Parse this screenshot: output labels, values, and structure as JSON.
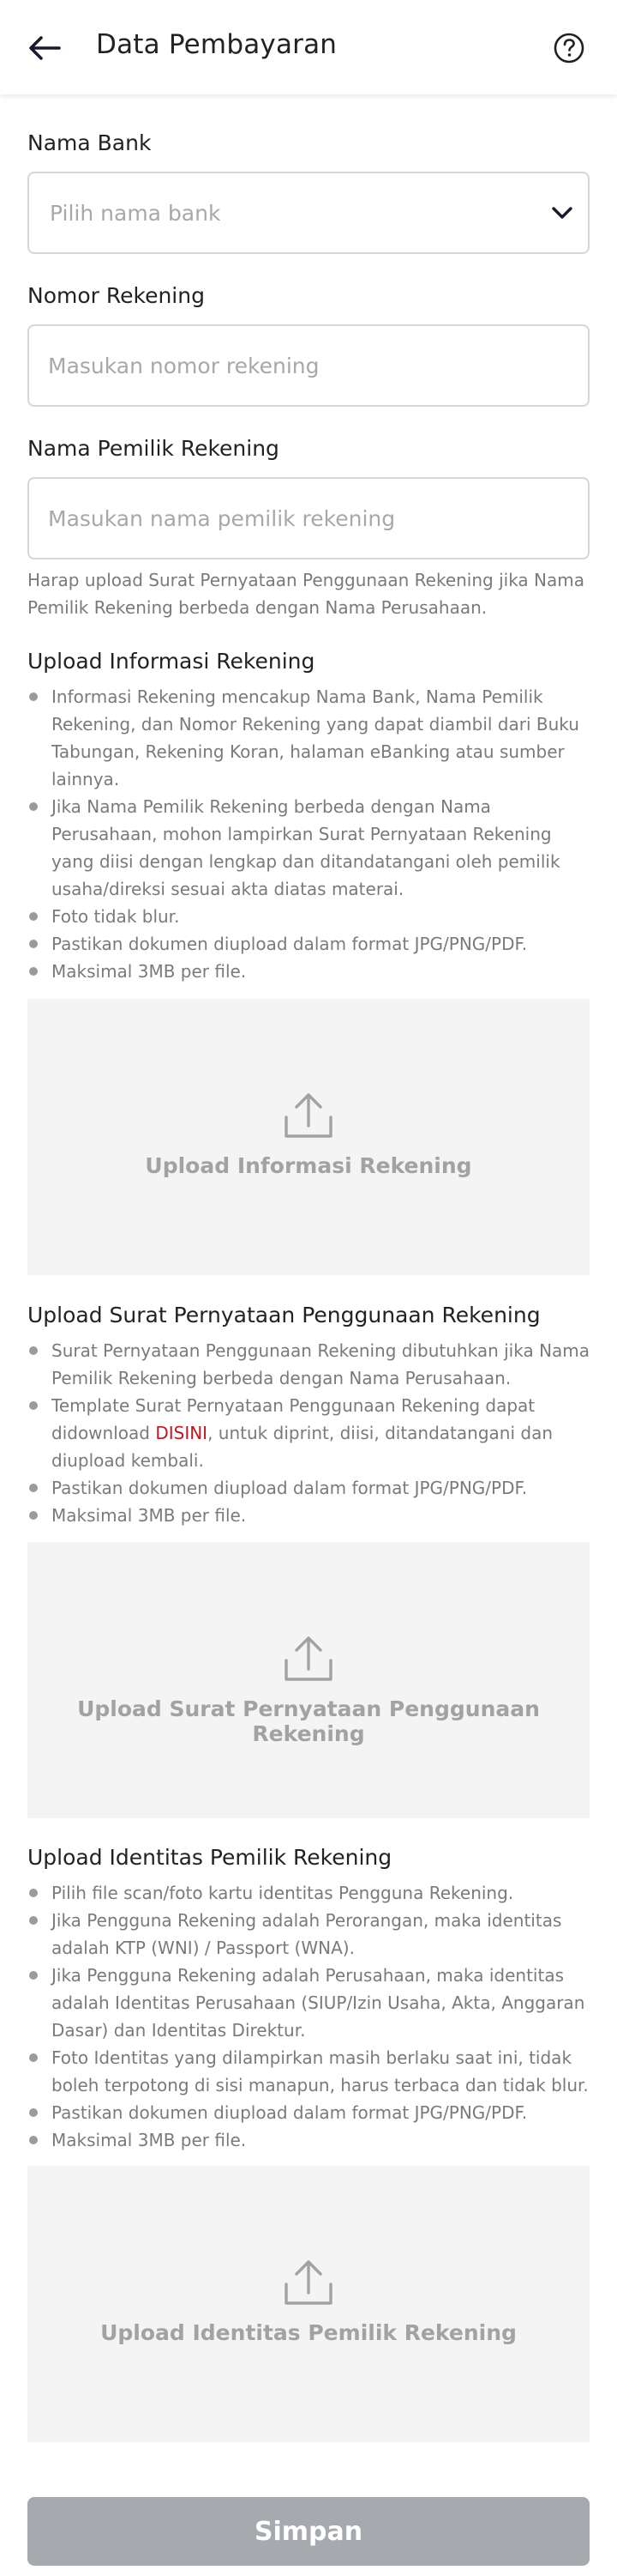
{
  "header": {
    "title": "Data Pembayaran"
  },
  "form": {
    "bank": {
      "label": "Nama Bank",
      "placeholder": "Pilih nama bank"
    },
    "account_number": {
      "label": "Nomor Rekening",
      "placeholder": "Masukan nomor rekening"
    },
    "account_owner": {
      "label": "Nama Pemilik Rekening",
      "placeholder": "Masukan nama pemilik rekening"
    },
    "owner_note": "Harap upload Surat Pernyataan Penggunaan Rekening jika Nama Pemilik Rekening berbeda dengan Nama Perusahaan."
  },
  "upload_info": {
    "title": "Upload Informasi Rekening",
    "bullets": [
      "Informasi Rekening mencakup Nama Bank, Nama Pemilik Rekening, dan Nomor Rekening yang dapat diambil dari Buku Tabungan, Rekening Koran, halaman eBanking atau sumber lainnya.",
      "Jika Nama Pemilik Rekening berbeda dengan Nama Perusahaan, mohon lampirkan Surat Pernyataan Rekening yang diisi dengan lengkap dan ditandatangani oleh pemilik usaha/direksi sesuai akta diatas materai.",
      "Foto tidak blur.",
      "Pastikan dokumen diupload dalam format JPG/PNG/PDF.",
      "Maksimal 3MB per file."
    ],
    "upload_label": "Upload Informasi Rekening"
  },
  "upload_statement": {
    "title": "Upload Surat Pernyataan Penggunaan Rekening",
    "bullet_1": "Surat Pernyataan Penggunaan Rekening dibutuhkan jika Nama Pemilik Rekening berbeda dengan Nama Perusahaan.",
    "bullet_2_before": "Template Surat Pernyataan Penggunaan Rekening dapat didownload ",
    "bullet_2_link": "DISINI",
    "bullet_2_after": ", untuk diprint, diisi, ditandatangani dan diupload kembali.",
    "bullet_3": "Pastikan dokumen diupload dalam format JPG/PNG/PDF.",
    "bullet_4": "Maksimal 3MB per file.",
    "upload_label": "Upload Surat Pernyataan Penggunaan Rekening"
  },
  "upload_identity": {
    "title": "Upload Identitas Pemilik Rekening",
    "bullets": [
      "Pilih file scan/foto kartu identitas Pengguna Rekening.",
      "Jika Pengguna Rekening adalah Perorangan, maka identitas adalah KTP (WNI) / Passport (WNA).",
      "Jika Pengguna Rekening adalah Perusahaan, maka identitas adalah Identitas Perusahaan (SIUP/Izin Usaha, Akta, Anggaran Dasar) dan Identitas Direktur.",
      "Foto Identitas yang dilampirkan masih berlaku saat ini, tidak boleh terpotong di sisi manapun, harus terbaca dan tidak blur.",
      "Pastikan dokumen diupload dalam format JPG/PNG/PDF.",
      "Maksimal 3MB per file."
    ],
    "upload_label": "Upload Identitas Pemilik Rekening"
  },
  "actions": {
    "save_label": "Simpan"
  },
  "colors": {
    "link": "#c4161c",
    "button_disabled": "#a6a9ae",
    "upload_bg": "#f4f4f4"
  },
  "icons": {
    "back": "arrow-left-icon",
    "help": "question-circle-icon",
    "dropdown": "chevron-down-icon",
    "upload": "upload-icon"
  }
}
